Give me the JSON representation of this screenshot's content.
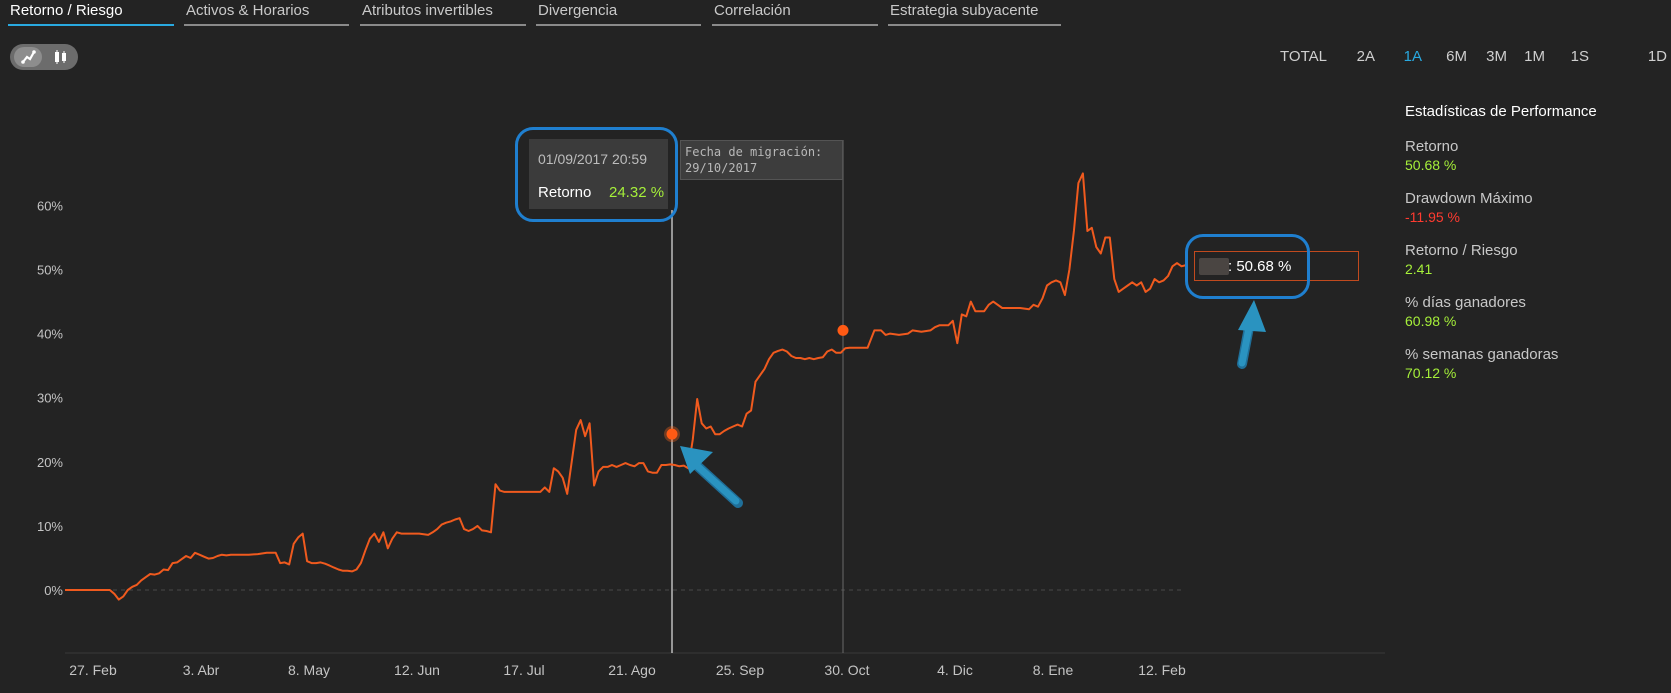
{
  "tabs": [
    {
      "label": "Retorno / Riesgo",
      "active": true
    },
    {
      "label": "Activos & Horarios",
      "active": false
    },
    {
      "label": "Atributos invertibles",
      "active": false
    },
    {
      "label": "Divergencia",
      "active": false
    },
    {
      "label": "Correlación",
      "active": false
    },
    {
      "label": "Estrategia subyacente",
      "active": false
    }
  ],
  "view_toggle": {
    "options": [
      "line-chart-icon",
      "candlestick-icon"
    ],
    "selected": "line-chart-icon"
  },
  "ranges": [
    {
      "label": "TOTAL",
      "active": false
    },
    {
      "label": "2A",
      "active": false
    },
    {
      "label": "1A",
      "active": true
    },
    {
      "label": "6M",
      "active": false
    },
    {
      "label": "3M",
      "active": false
    },
    {
      "label": "1M",
      "active": false
    },
    {
      "label": "1S",
      "active": false
    },
    {
      "label": "1D",
      "active": false
    }
  ],
  "tooltip": {
    "date": "01/09/2017 20:59",
    "label": "Retorno",
    "value": "24.32 %"
  },
  "migration": {
    "line1": "Fecha de migración:",
    "line2": "29/10/2017"
  },
  "current_value": {
    "text": ": 50.68 %"
  },
  "stats": {
    "title": "Estadísticas de Performance",
    "items": [
      {
        "name": "Retorno",
        "value": "50.68 %",
        "tone": "green"
      },
      {
        "name": "Drawdown Máximo",
        "value": "-11.95 %",
        "tone": "red"
      },
      {
        "name": "Retorno / Riesgo",
        "value": "2.41",
        "tone": "green"
      },
      {
        "name": "% días ganadores",
        "value": "60.98 %",
        "tone": "green"
      },
      {
        "name": "% semanas ganadoras",
        "value": "70.12 %",
        "tone": "green"
      }
    ]
  },
  "colors": {
    "line": "#f05a1e",
    "accent": "#29a9e0",
    "positive": "#a6f03a",
    "negative": "#ff3b30",
    "highlight": "#1f7fcf"
  },
  "chart_data": {
    "type": "line",
    "ylim": [
      -10,
      70
    ],
    "y_ticks": [
      0,
      10,
      20,
      30,
      40,
      50,
      60
    ],
    "y_tick_labels": [
      "0%",
      "10%",
      "20%",
      "30%",
      "40%",
      "50%",
      "60%"
    ],
    "x_tick_labels": [
      "27. Feb",
      "3. Abr",
      "8. May",
      "12. Jun",
      "17. Jul",
      "21. Ago",
      "25. Sep",
      "30. Oct",
      "4. Dic",
      "8. Ene",
      "12. Feb"
    ],
    "x_range": [
      "2017-02-20",
      "2018-03-24"
    ],
    "series": [
      {
        "values": [
          [
            0,
            0
          ],
          [
            4,
            0
          ],
          [
            8,
            0
          ],
          [
            12,
            0
          ],
          [
            16,
            0
          ],
          [
            20,
            0
          ],
          [
            22,
            -0.6
          ],
          [
            24,
            -1.5
          ],
          [
            26,
            -1
          ],
          [
            28,
            0
          ],
          [
            30,
            0.5
          ],
          [
            32,
            0.8
          ],
          [
            34,
            1.5
          ],
          [
            36,
            2
          ],
          [
            38,
            2.5
          ],
          [
            40,
            2.4
          ],
          [
            42,
            2.6
          ],
          [
            44,
            3.2
          ],
          [
            46,
            3.1
          ],
          [
            48,
            4.2
          ],
          [
            50,
            4.3
          ],
          [
            52,
            4.8
          ],
          [
            54,
            5.3
          ],
          [
            56,
            5
          ],
          [
            58,
            5.8
          ],
          [
            60,
            5.5
          ],
          [
            62,
            5.2
          ],
          [
            64,
            4.9
          ],
          [
            66,
            5
          ],
          [
            68,
            5.3
          ],
          [
            70,
            5.5
          ],
          [
            72,
            5.4
          ],
          [
            74,
            5.5
          ],
          [
            78,
            5.5
          ],
          [
            82,
            5.5
          ],
          [
            86,
            5.6
          ],
          [
            90,
            5.8
          ],
          [
            94,
            5.8
          ],
          [
            96,
            4.2
          ],
          [
            98,
            4.3
          ],
          [
            100,
            4
          ],
          [
            102,
            7.2
          ],
          [
            104,
            8.2
          ],
          [
            106,
            8.8
          ],
          [
            108,
            4.5
          ],
          [
            110,
            4.2
          ],
          [
            112,
            4.2
          ],
          [
            114,
            4.3
          ],
          [
            116,
            4.1
          ],
          [
            118,
            3.8
          ],
          [
            120,
            3.5
          ],
          [
            122,
            3.2
          ],
          [
            124,
            3
          ],
          [
            126,
            3
          ],
          [
            128,
            2.9
          ],
          [
            130,
            3.2
          ],
          [
            132,
            4.2
          ],
          [
            134,
            6.2
          ],
          [
            136,
            8
          ],
          [
            138,
            8.8
          ],
          [
            140,
            7.5
          ],
          [
            142,
            9
          ],
          [
            144,
            6.5
          ],
          [
            146,
            8
          ],
          [
            148,
            9
          ],
          [
            150,
            8.8
          ],
          [
            154,
            8.8
          ],
          [
            158,
            8.8
          ],
          [
            162,
            8.6
          ],
          [
            164,
            9
          ],
          [
            166,
            9.5
          ],
          [
            168,
            10.2
          ],
          [
            170,
            10.5
          ],
          [
            172,
            10.7
          ],
          [
            174,
            11
          ],
          [
            176,
            11.2
          ],
          [
            178,
            9.5
          ],
          [
            180,
            9.2
          ],
          [
            182,
            9.5
          ],
          [
            184,
            10
          ],
          [
            186,
            9.3
          ],
          [
            188,
            9.2
          ],
          [
            190,
            9
          ],
          [
            192,
            16.5
          ],
          [
            194,
            15.5
          ],
          [
            196,
            15.3
          ],
          [
            200,
            15.3
          ],
          [
            204,
            15.3
          ],
          [
            208,
            15.3
          ],
          [
            212,
            15.3
          ],
          [
            214,
            16
          ],
          [
            216,
            15.3
          ],
          [
            218,
            19
          ],
          [
            220,
            18.5
          ],
          [
            222,
            17.5
          ],
          [
            224,
            15
          ],
          [
            226,
            20
          ],
          [
            228,
            25
          ],
          [
            230,
            26.5
          ],
          [
            232,
            24
          ],
          [
            234,
            26
          ],
          [
            236,
            16.3
          ],
          [
            238,
            18.5
          ],
          [
            240,
            19.2
          ],
          [
            242,
            19.2
          ],
          [
            244,
            19.5
          ],
          [
            246,
            19.2
          ],
          [
            248,
            19.5
          ],
          [
            250,
            19.8
          ],
          [
            252,
            19.5
          ],
          [
            254,
            19.3
          ],
          [
            256,
            19.8
          ],
          [
            258,
            19.8
          ],
          [
            260,
            18.5
          ],
          [
            262,
            18.3
          ],
          [
            264,
            18.3
          ],
          [
            266,
            19.5
          ],
          [
            268,
            19.5
          ],
          [
            270,
            19.6
          ],
          [
            272,
            19.5
          ],
          [
            274,
            19.3
          ],
          [
            276,
            19.4
          ],
          [
            278,
            19
          ],
          [
            280,
            23.5
          ],
          [
            282,
            29.8
          ],
          [
            284,
            26
          ],
          [
            286,
            25.2
          ],
          [
            288,
            25.5
          ],
          [
            290,
            24.3
          ],
          [
            292,
            24.3
          ],
          [
            294,
            24.8
          ],
          [
            296,
            25.2
          ],
          [
            298,
            25.5
          ],
          [
            300,
            25.8
          ],
          [
            302,
            25.5
          ],
          [
            304,
            27.5
          ],
          [
            306,
            28
          ],
          [
            308,
            32.5
          ],
          [
            310,
            33.5
          ],
          [
            312,
            34.5
          ],
          [
            314,
            36
          ],
          [
            316,
            37
          ],
          [
            318,
            37.3
          ],
          [
            320,
            37.5
          ],
          [
            322,
            37.2
          ],
          [
            324,
            36.5
          ],
          [
            326,
            36.2
          ],
          [
            328,
            36.2
          ],
          [
            330,
            36
          ],
          [
            332,
            36.2
          ],
          [
            334,
            36
          ],
          [
            336,
            36.2
          ],
          [
            338,
            36.3
          ],
          [
            340,
            37.2
          ],
          [
            342,
            37.5
          ],
          [
            344,
            37
          ],
          [
            346,
            37
          ],
          [
            348,
            37.7
          ],
          [
            350,
            37.8
          ],
          [
            354,
            37.8
          ],
          [
            358,
            37.8
          ],
          [
            361,
            40.5
          ],
          [
            364,
            40.5
          ],
          [
            366,
            39.8
          ],
          [
            368,
            40
          ],
          [
            372,
            39.8
          ],
          [
            376,
            40
          ],
          [
            378,
            40.5
          ],
          [
            382,
            40.3
          ],
          [
            386,
            40.5
          ],
          [
            388,
            41
          ],
          [
            390,
            41.3
          ],
          [
            394,
            41.3
          ],
          [
            396,
            42
          ],
          [
            398,
            38.5
          ],
          [
            400,
            43
          ],
          [
            402,
            42.7
          ],
          [
            404,
            45
          ],
          [
            406,
            43.5
          ],
          [
            408,
            43.5
          ],
          [
            410,
            43.5
          ],
          [
            412,
            44.5
          ],
          [
            414,
            45
          ],
          [
            418,
            44
          ],
          [
            422,
            44
          ],
          [
            426,
            44
          ],
          [
            430,
            43.8
          ],
          [
            432,
            44.5
          ],
          [
            434,
            44.2
          ],
          [
            436,
            45.5
          ],
          [
            438,
            47.5
          ],
          [
            440,
            48
          ],
          [
            442,
            48.3
          ],
          [
            444,
            48
          ],
          [
            446,
            46
          ],
          [
            448,
            50
          ],
          [
            450,
            56
          ],
          [
            452,
            63.5
          ],
          [
            454,
            65
          ],
          [
            456,
            56
          ],
          [
            458,
            56.5
          ],
          [
            460,
            53.5
          ],
          [
            462,
            52.5
          ],
          [
            464,
            55
          ],
          [
            466,
            55
          ],
          [
            468,
            48.5
          ],
          [
            470,
            46.5
          ],
          [
            472,
            47
          ],
          [
            474,
            47.5
          ],
          [
            476,
            48
          ],
          [
            478,
            47.5
          ],
          [
            480,
            48
          ],
          [
            482,
            46.5
          ],
          [
            484,
            47
          ],
          [
            486,
            48.5
          ],
          [
            488,
            48
          ],
          [
            490,
            48.3
          ],
          [
            492,
            49
          ],
          [
            494,
            50.5
          ],
          [
            496,
            51
          ],
          [
            498,
            50.5
          ],
          [
            500,
            50.68
          ]
        ]
      }
    ],
    "markers": [
      {
        "x": "2017-09-01",
        "y": 24.32,
        "type": "hover-point"
      },
      {
        "x": "2017-10-29",
        "y": 40.5,
        "type": "migration-point"
      }
    ],
    "grid": false
  }
}
